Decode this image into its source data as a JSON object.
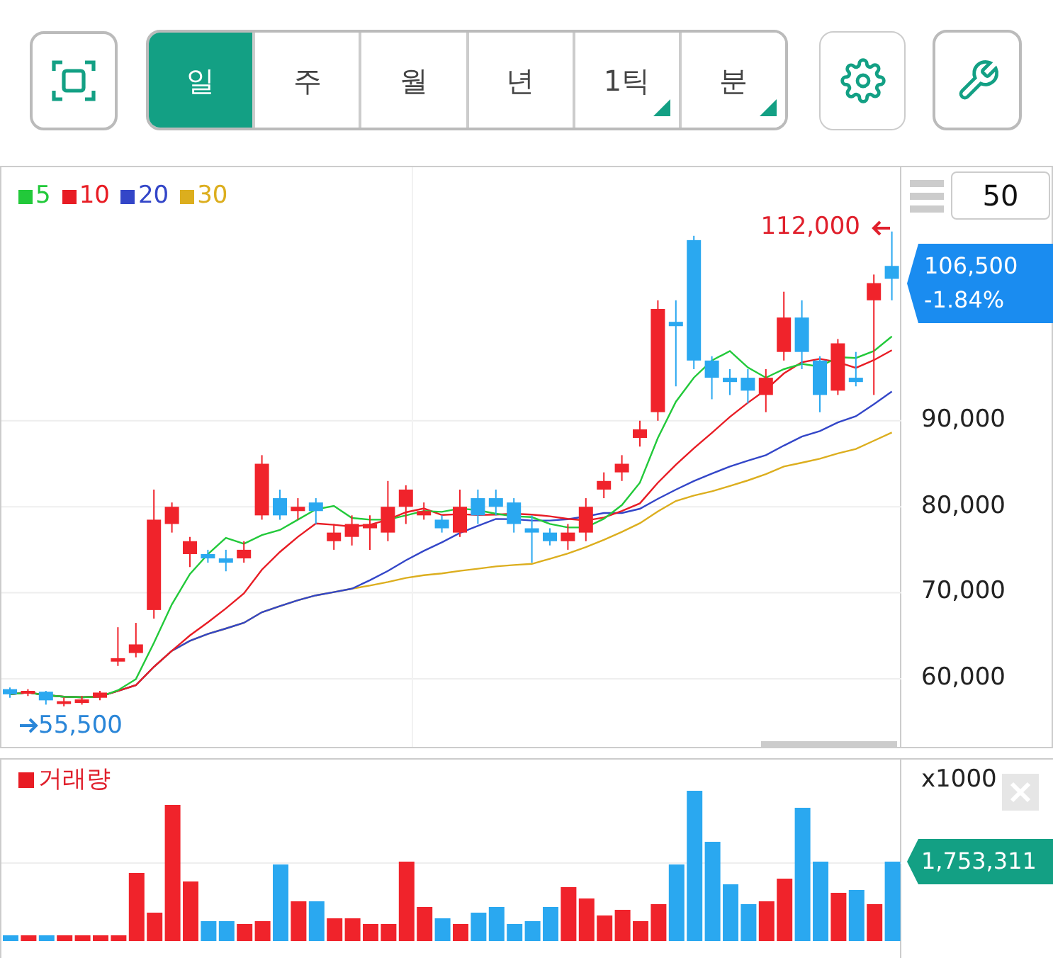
{
  "toolbar": {
    "tabs": [
      {
        "label": "일",
        "selected": true,
        "has_submenu": false
      },
      {
        "label": "주",
        "selected": false,
        "has_submenu": false
      },
      {
        "label": "월",
        "selected": false,
        "has_submenu": false
      },
      {
        "label": "년",
        "selected": false,
        "has_submenu": false
      },
      {
        "label": "1틱",
        "selected": false,
        "has_submenu": true
      },
      {
        "label": "분",
        "selected": false,
        "has_submenu": true
      }
    ]
  },
  "price_chart": {
    "legend": [
      {
        "label": "5",
        "color": "#22c93a"
      },
      {
        "label": "10",
        "color": "#e81c24"
      },
      {
        "label": "20",
        "color": "#3346c8"
      },
      {
        "label": "30",
        "color": "#dcae1e"
      }
    ],
    "candle_count": "50",
    "high_label": "112,000",
    "low_label": "55,500",
    "current_price": "106,500",
    "change": "-1.84%",
    "y_axis_labels": [
      "90,000",
      "80,000",
      "70,000",
      "60,000"
    ]
  },
  "volume_chart": {
    "legend": "거래량",
    "unit": "x1000",
    "current_volume": "1,753,311"
  }
}
